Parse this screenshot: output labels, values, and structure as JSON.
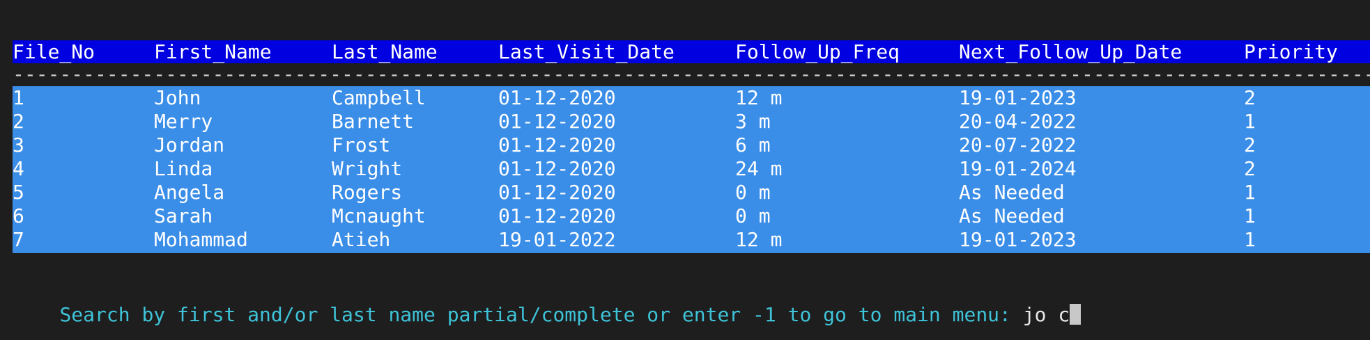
{
  "table": {
    "headers": [
      "File_No",
      "First_Name",
      "Last_Name",
      "Last_Visit_Date",
      "Follow_Up_Freq",
      "Next_Follow_Up_Date",
      "Priority"
    ],
    "separator": "-----------------------------------------------------------------------------------------------------------------------------------------------------------------------------------------",
    "rows": [
      [
        "1",
        "John",
        "Campbell",
        "01-12-2020",
        "12 m",
        "19-01-2023",
        "2"
      ],
      [
        "2",
        "Merry",
        "Barnett",
        "01-12-2020",
        "3 m",
        "20-04-2022",
        "1"
      ],
      [
        "3",
        "Jordan",
        "Frost",
        "01-12-2020",
        "6 m",
        "20-07-2022",
        "2"
      ],
      [
        "4",
        "Linda",
        "Wright",
        "01-12-2020",
        "24 m",
        "19-01-2024",
        "2"
      ],
      [
        "5",
        "Angela",
        "Rogers",
        "01-12-2020",
        "0 m",
        "As Needed",
        "1"
      ],
      [
        "6",
        "Sarah",
        "Mcnaught",
        "01-12-2020",
        "0 m",
        "As Needed",
        "1"
      ],
      [
        "7",
        "Mohammad",
        "Atieh",
        "19-01-2022",
        "12 m",
        "19-01-2023",
        "1"
      ]
    ]
  },
  "prompt": {
    "text": "Search by first and/or last name partial/complete or enter -1 to go to main menu: ",
    "input": "jo c"
  },
  "colors": {
    "background": "#1e1e1e",
    "header_bg": "#0000e0",
    "selection_bg": "#3b8ee8",
    "prompt": "#3ec3d8"
  }
}
